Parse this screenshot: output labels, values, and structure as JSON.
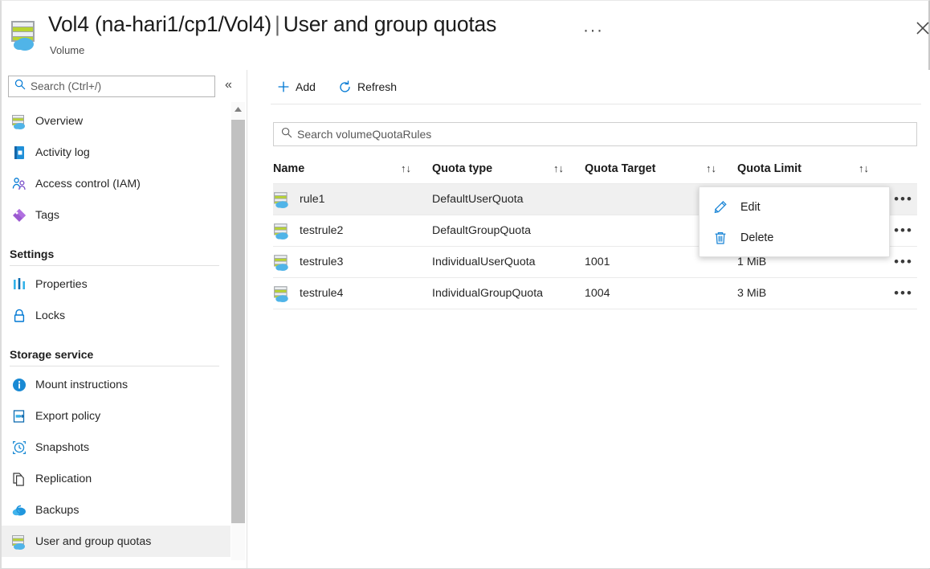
{
  "header": {
    "icon": "volume-icon",
    "title_resource": "Vol4 (na-hari1/cp1/Vol4)",
    "separator": "|",
    "title_page": "User and group quotas",
    "ellipsis": "···",
    "subtitle": "Volume",
    "close_icon": "close-icon"
  },
  "sidebar": {
    "search": {
      "placeholder": "Search (Ctrl+/)",
      "value": "",
      "icon": "search-icon"
    },
    "collapse_icon": "«",
    "items": [
      {
        "label": "Overview",
        "icon": "volume-icon",
        "selected": false
      },
      {
        "label": "Activity log",
        "icon": "activity-log-icon",
        "selected": false
      },
      {
        "label": "Access control (IAM)",
        "icon": "access-control-icon",
        "selected": false
      },
      {
        "label": "Tags",
        "icon": "tag-icon",
        "selected": false
      }
    ],
    "sections": [
      {
        "title": "Settings",
        "items": [
          {
            "label": "Properties",
            "icon": "properties-icon",
            "selected": false
          },
          {
            "label": "Locks",
            "icon": "lock-icon",
            "selected": false
          }
        ]
      },
      {
        "title": "Storage service",
        "items": [
          {
            "label": "Mount instructions",
            "icon": "info-icon",
            "selected": false
          },
          {
            "label": "Export policy",
            "icon": "export-policy-icon",
            "selected": false
          },
          {
            "label": "Snapshots",
            "icon": "snapshot-icon",
            "selected": false
          },
          {
            "label": "Replication",
            "icon": "replication-icon",
            "selected": false
          },
          {
            "label": "Backups",
            "icon": "backup-icon",
            "selected": false
          },
          {
            "label": "User and group quotas",
            "icon": "volume-icon",
            "selected": true
          }
        ]
      }
    ]
  },
  "toolbar": {
    "add_label": "Add",
    "add_icon": "plus-icon",
    "refresh_label": "Refresh",
    "refresh_icon": "refresh-icon"
  },
  "grid": {
    "search": {
      "placeholder": "Search volumeQuotaRules",
      "value": "",
      "icon": "search-icon"
    },
    "columns": [
      {
        "label": "Name",
        "sort_icon": "↑↓"
      },
      {
        "label": "Quota type",
        "sort_icon": "↑↓"
      },
      {
        "label": "Quota Target",
        "sort_icon": "↑↓"
      },
      {
        "label": "Quota Limit",
        "sort_icon": "↑↓"
      }
    ],
    "rows": [
      {
        "name": "rule1",
        "quota_type": "DefaultUserQuota",
        "quota_target": "",
        "quota_limit": "",
        "selected": true,
        "actions_icon": "•••"
      },
      {
        "name": "testrule2",
        "quota_type": "DefaultGroupQuota",
        "quota_target": "",
        "quota_limit": "",
        "selected": false,
        "actions_icon": "•••"
      },
      {
        "name": "testrule3",
        "quota_type": "IndividualUserQuota",
        "quota_target": "1001",
        "quota_limit": "1 MiB",
        "selected": false,
        "actions_icon": "•••"
      },
      {
        "name": "testrule4",
        "quota_type": "IndividualGroupQuota",
        "quota_target": "1004",
        "quota_limit": "3 MiB",
        "selected": false,
        "actions_icon": "•••"
      }
    ]
  },
  "context_menu": {
    "items": [
      {
        "label": "Edit",
        "icon": "pencil-icon"
      },
      {
        "label": "Delete",
        "icon": "trash-icon"
      }
    ]
  },
  "colors": {
    "accent": "#0078d4",
    "icon_blue": "#0078d4",
    "selected_row": "#f0f0f0",
    "cloud": "#50b4e8",
    "green": "#b8d432"
  }
}
